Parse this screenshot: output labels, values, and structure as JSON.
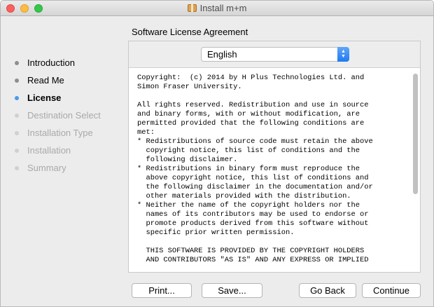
{
  "window": {
    "title": "Install m+m"
  },
  "heading": "Software License Agreement",
  "steps": [
    {
      "label": "Introduction",
      "state": "done"
    },
    {
      "label": "Read Me",
      "state": "done"
    },
    {
      "label": "License",
      "state": "current"
    },
    {
      "label": "Destination Select",
      "state": "pending"
    },
    {
      "label": "Installation Type",
      "state": "pending"
    },
    {
      "label": "Installation",
      "state": "pending"
    },
    {
      "label": "Summary",
      "state": "pending"
    }
  ],
  "language": {
    "selected": "English"
  },
  "license_text": "Copyright:  (c) 2014 by H Plus Technologies Ltd. and\nSimon Fraser University.\n\nAll rights reserved. Redistribution and use in source\nand binary forms, with or without modification, are\npermitted provided that the following conditions are\nmet:\n* Redistributions of source code must retain the above\n  copyright notice, this list of conditions and the\n  following disclaimer.\n* Redistributions in binary form must reproduce the\n  above copyright notice, this list of conditions and\n  the following disclaimer in the documentation and/or\n  other materials provided with the distribution.\n* Neither the name of the copyright holders nor the\n  names of its contributors may be used to endorse or\n  promote products derived from this software without\n  specific prior written permission.\n\n  THIS SOFTWARE IS PROVIDED BY THE COPYRIGHT HOLDERS\n  AND CONTRIBUTORS \"AS IS\" AND ANY EXPRESS OR IMPLIED",
  "buttons": {
    "print": "Print...",
    "save": "Save...",
    "back": "Go Back",
    "continue": "Continue"
  },
  "icons": {
    "close": "close-button-icon",
    "minimize": "minimize-button-icon",
    "zoom": "zoom-button-icon",
    "package": "package-icon",
    "popup": "popup-chevron-icon"
  },
  "colors": {
    "accent": "#4a9ae9",
    "close": "#fc605c",
    "minimize": "#fdbc40",
    "zoom": "#34c84a"
  }
}
